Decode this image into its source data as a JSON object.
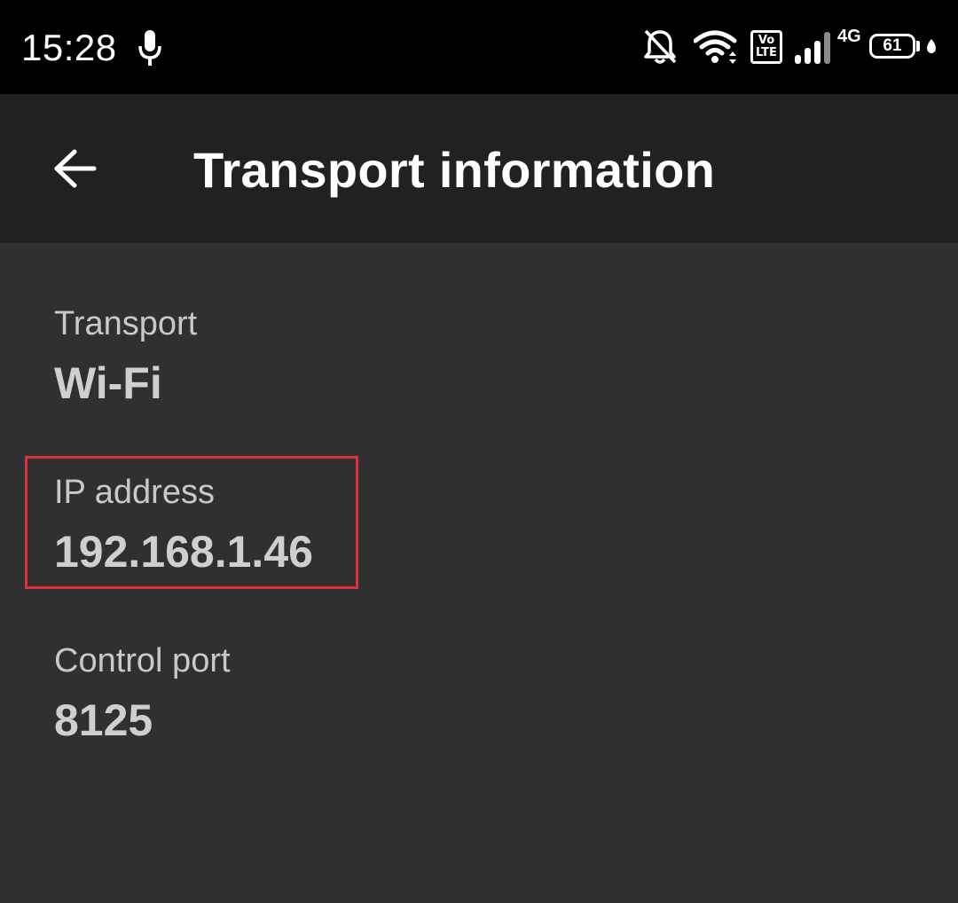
{
  "status_bar": {
    "time": "15:28",
    "network_type": "4G",
    "volte_label_top": "Vo",
    "volte_label_bottom": "LTE",
    "battery_level": "61",
    "icons": [
      "microphone-icon",
      "notifications-off-icon",
      "wifi-icon",
      "volte-icon",
      "signal-icon",
      "battery-icon",
      "data-saver-icon"
    ]
  },
  "app_bar": {
    "title": "Transport information",
    "back_icon": "arrow-back-icon"
  },
  "transport_info": {
    "transport": {
      "label": "Transport",
      "value": "Wi-Fi"
    },
    "ip_address": {
      "label": "IP address",
      "value": "192.168.1.46"
    },
    "control_port": {
      "label": "Control port",
      "value": "8125"
    }
  },
  "colors": {
    "status_bar_bg": "#000000",
    "app_bar_bg": "#212121",
    "content_bg": "#303030",
    "highlight_border": "#e03040",
    "label_text": "#c9c9c9",
    "value_text": "#cfcfcf"
  }
}
